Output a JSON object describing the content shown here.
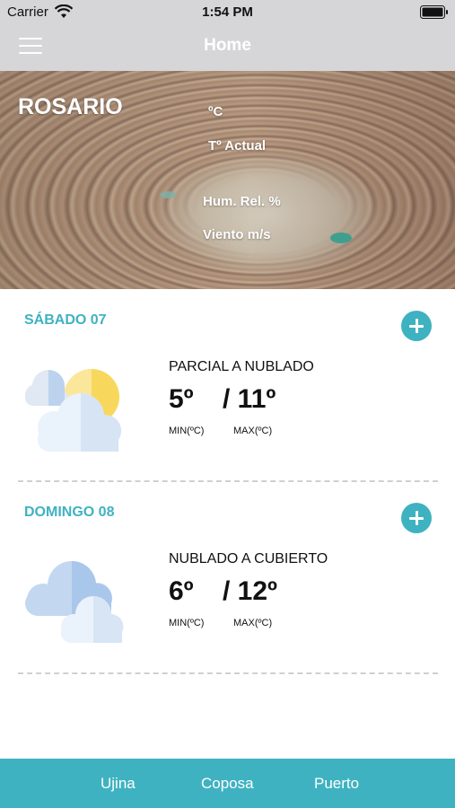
{
  "status_bar": {
    "carrier": "Carrier",
    "time": "1:54 PM"
  },
  "nav": {
    "title": "Home",
    "menu_icon": "hamburger-menu-icon"
  },
  "current": {
    "city": "ROSARIO",
    "unit": "ºC",
    "actual_label": "Tº Actual",
    "humidity_label": "Hum. Rel. %",
    "wind_label": "Viento   m/s"
  },
  "forecast": [
    {
      "date": "SÁBADO 07",
      "description": "PARCIAL A NUBLADO",
      "min": "5º",
      "max": "/ 11º",
      "min_label": "MIN(ºC)",
      "max_label": "MAX(ºC)",
      "icon": "partly-cloudy-icon"
    },
    {
      "date": "DOMINGO 08",
      "description": "NUBLADO A CUBIERTO",
      "min": "6º",
      "max": "/ 12º",
      "min_label": "MIN(ºC)",
      "max_label": "MAX(ºC)",
      "icon": "cloudy-icon"
    }
  ],
  "tabs": [
    "Ujina",
    "Coposa",
    "Puerto"
  ],
  "colors": {
    "accent": "#3fb2c1",
    "bar": "#d6d6d8"
  }
}
